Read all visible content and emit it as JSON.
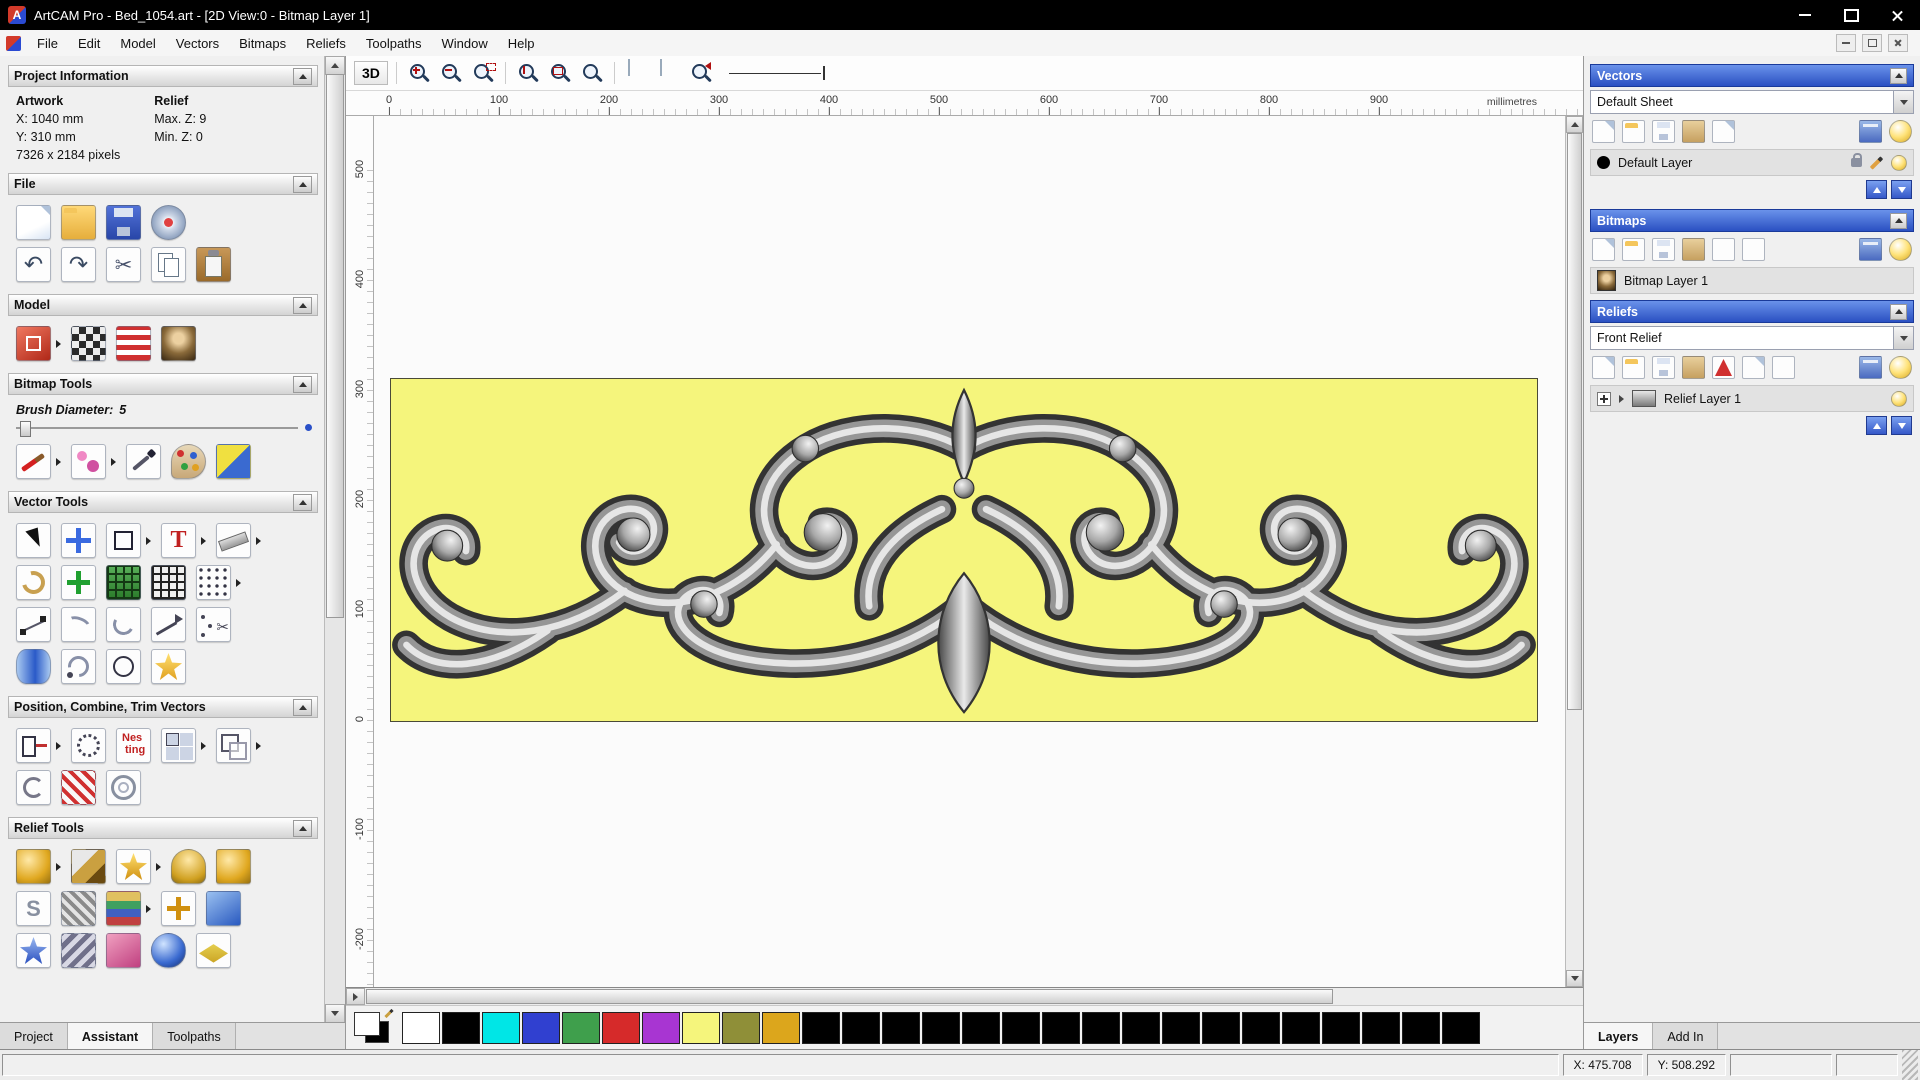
{
  "theme": {
    "titlebar_bg": "#000000",
    "panel_bg": "#f0f0f0",
    "header_blue_top": "#6a92ea",
    "header_blue_bottom": "#2a50c2",
    "selection_bg": "#e2e2e2",
    "artwork_bg": "#f5f57c"
  },
  "window": {
    "title": "ArtCAM Pro - Bed_1054.art - [2D View:0 - Bitmap Layer 1]"
  },
  "menu": {
    "items": [
      "File",
      "Edit",
      "Model",
      "Vectors",
      "Bitmaps",
      "Reliefs",
      "Toolpaths",
      "Window",
      "Help"
    ]
  },
  "left_panel": {
    "project_information": {
      "title": "Project Information",
      "artwork_label": "Artwork",
      "relief_label": "Relief",
      "x": "X: 1040 mm",
      "y": "Y: 310 mm",
      "max_z": "Max. Z: 9",
      "min_z": "Min. Z: 0",
      "pixels": "7326 x 2184 pixels"
    },
    "file": {
      "title": "File"
    },
    "model": {
      "title": "Model"
    },
    "bitmap_tools": {
      "title": "Bitmap Tools",
      "brush_label": "Brush Diameter:",
      "brush_value": "5"
    },
    "vector_tools": {
      "title": "Vector Tools"
    },
    "position_tools": {
      "title": "Position, Combine, Trim Vectors"
    },
    "relief_tools": {
      "title": "Relief Tools"
    },
    "tabs": [
      "Project",
      "Assistant",
      "Toolpaths"
    ],
    "active_tab": "Assistant"
  },
  "toolbar": {
    "btn_3d": "3D"
  },
  "ruler": {
    "unit": "millimetres",
    "h_ticks": [
      "0",
      "100",
      "200",
      "300",
      "400",
      "500",
      "600",
      "700",
      "800",
      "900"
    ],
    "v_ticks": [
      "500",
      "400",
      "300",
      "200",
      "100",
      "0",
      "-100",
      "-200"
    ]
  },
  "right_panel": {
    "vectors": {
      "title": "Vectors",
      "sheet": "Default Sheet",
      "layer": "Default Layer"
    },
    "bitmaps": {
      "title": "Bitmaps",
      "layer": "Bitmap Layer 1"
    },
    "reliefs": {
      "title": "Reliefs",
      "selected": "Front Relief",
      "layer": "Relief Layer 1"
    },
    "tabs": [
      "Layers",
      "Add In"
    ],
    "active_tab": "Layers"
  },
  "palette": {
    "colors": [
      "#ffffff",
      "#000000",
      "#00e6e6",
      "#3040d0",
      "#3f9f4c",
      "#d62a2a",
      "#a835d2",
      "#f5f57c",
      "#8f8f38",
      "#dca61c",
      "#000000",
      "#000000",
      "#000000",
      "#000000",
      "#000000",
      "#000000",
      "#000000",
      "#000000",
      "#000000",
      "#000000",
      "#000000",
      "#000000",
      "#000000",
      "#000000",
      "#000000",
      "#000000",
      "#000000"
    ]
  },
  "status": {
    "x": "X: 475.708",
    "y": "Y: 508.292"
  }
}
